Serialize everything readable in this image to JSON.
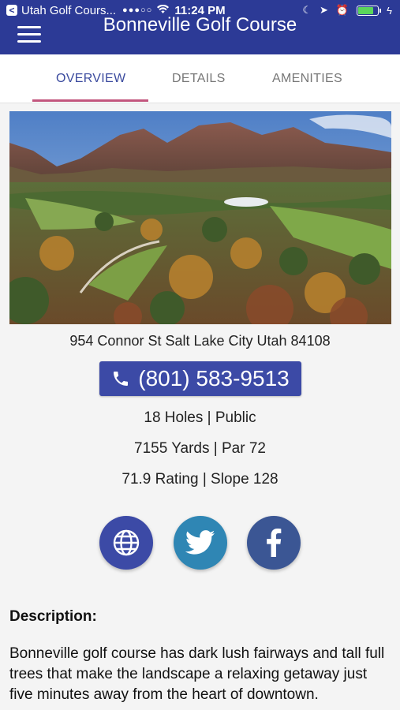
{
  "status_bar": {
    "back_glyph": "<",
    "carrier": "Utah Golf Cours...",
    "signal": "●●●○○",
    "time": "11:24 PM"
  },
  "nav": {
    "title": "Bonneville Golf Course",
    "menu_icon": "hamburger-menu-icon"
  },
  "tabs": [
    {
      "label": "OVERVIEW",
      "active": true
    },
    {
      "label": "DETAILS",
      "active": false
    },
    {
      "label": "AMENITIES",
      "active": false
    }
  ],
  "course": {
    "address": "954 Connor St Salt Lake City Utah 84108",
    "phone": "(801) 583-9513",
    "holes": "18 Holes | Public",
    "yards": "7155 Yards | Par 72",
    "rating": "71.9 Rating | Slope 128"
  },
  "social": [
    {
      "icon": "globe-icon",
      "color": "#3c4aa6"
    },
    {
      "icon": "twitter-icon",
      "color": "#2f86b4"
    },
    {
      "icon": "facebook-icon",
      "color": "#3b5694"
    }
  ],
  "description": {
    "title": "Description:",
    "body": "Bonneville golf course has dark lush fairways and tall full trees that make the landscape a relaxing getaway just five minutes away from the heart of downtown."
  },
  "colors": {
    "header": "#2c3a96",
    "tab_active": "#3a4a9e",
    "tab_underline": "#c2567e",
    "phone_button": "#3c4aa6"
  }
}
